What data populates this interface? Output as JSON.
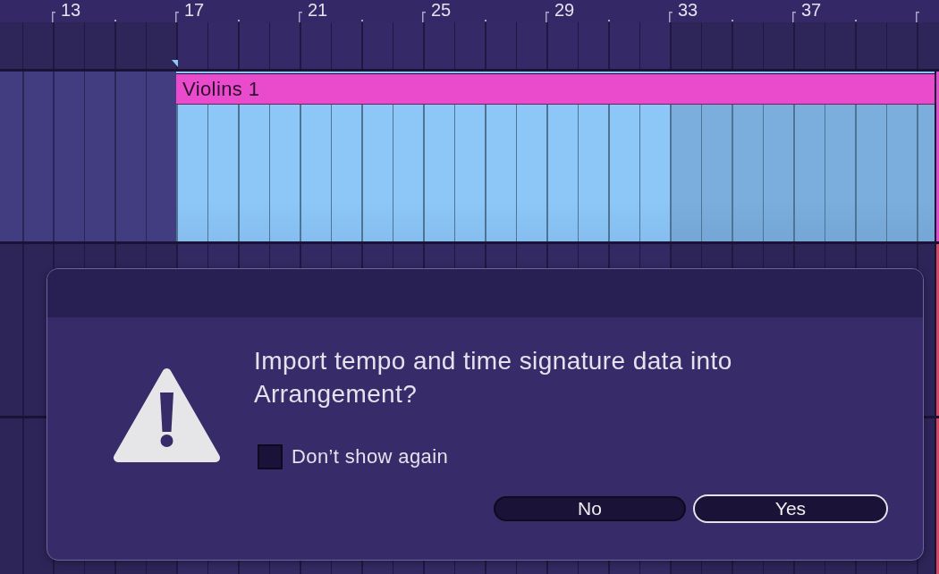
{
  "ruler": {
    "bar_labels": [
      "13",
      "17",
      "21",
      "25",
      "29",
      "33",
      "37"
    ]
  },
  "track": {
    "clip": {
      "name": "Violins 1",
      "selected": true
    }
  },
  "dialog": {
    "message": "Import tempo and time signature data into Arrangement?",
    "checkbox": {
      "label": "Don’t show again",
      "checked": false
    },
    "buttons": [
      {
        "label": "No",
        "default": false
      },
      {
        "label": "Yes",
        "default": true
      }
    ]
  }
}
